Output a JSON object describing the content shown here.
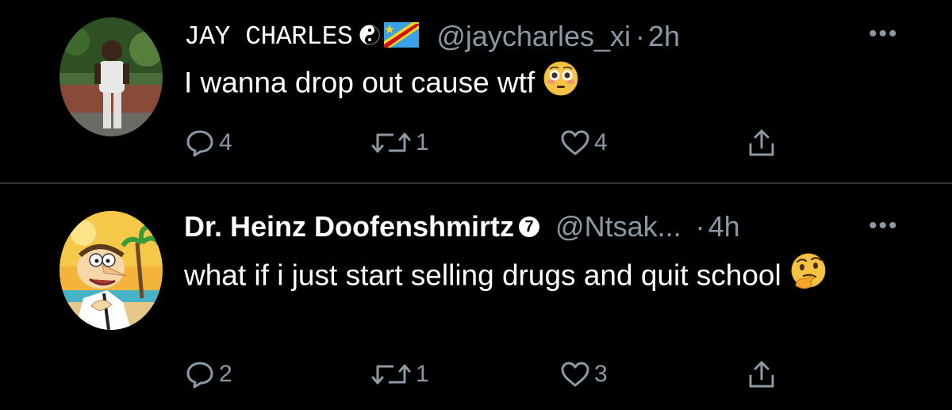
{
  "tweets": [
    {
      "display_name": "JAY CHARLES",
      "handle": "@jaycharles_xi",
      "separator": "·",
      "time": "2h",
      "text": "I wanna drop out cause wtf",
      "emoji": "flushed-face-emoji",
      "replies": "4",
      "retweets": "1",
      "likes": "4",
      "name_icons": [
        "yin-yang-icon",
        "dr-congo-flag-icon"
      ]
    },
    {
      "display_name": "Dr. Heinz Doofenshmirtz",
      "badge": "7",
      "handle": "@Ntsak...",
      "separator": "·",
      "time": "4h",
      "text": "what if i just start selling drugs and quit school",
      "emoji": "thinking-face-emoji",
      "replies": "2",
      "retweets": "1",
      "likes": "3"
    }
  ],
  "more_label": "•••",
  "colors": {
    "background": "#000000",
    "text": "#ffffff",
    "secondary": "#8b98a5",
    "divider": "#2f3336"
  }
}
